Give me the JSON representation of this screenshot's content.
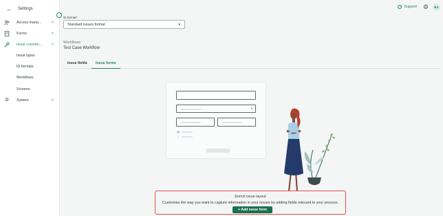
{
  "sidebar": {
    "title": "Settings",
    "back_icon": "arrow-left-icon",
    "collapse_icon": "chevron-left-icon",
    "items": [
      {
        "label": "Access mana...",
        "icon": "people-icon",
        "chevron": "˅"
      },
      {
        "label": "Forms",
        "icon": "form-icon",
        "chevron": "˅"
      },
      {
        "label": "Issue customi...",
        "icon": "wrench-icon",
        "chevron": "˄"
      },
      {
        "label": "System",
        "icon": "gear-icon",
        "chevron": "˅"
      }
    ],
    "subitems": [
      "Issue types",
      "ID formats",
      "Workflows",
      "Screens"
    ]
  },
  "topbar": {
    "support_label": "Support",
    "avatar_initials": "BA"
  },
  "main": {
    "id_format_label": "ID format*",
    "id_format_value": "Standard issues format",
    "workflows_label": "Workflows",
    "workflow_value": "Test Case Workflow",
    "tabs": [
      {
        "label": "Issue fields",
        "active": false
      },
      {
        "label": "Issue forms",
        "active": true
      }
    ]
  },
  "callout": {
    "title": "Enrich issue layout",
    "body": "Customise the way you want to capture information in your issues by adding fields relevant to your process.",
    "button_label": "Add issue form"
  },
  "colors": {
    "accent": "#1f8a62",
    "button": "#1a6f50",
    "highlight_border": "#e2504a"
  }
}
